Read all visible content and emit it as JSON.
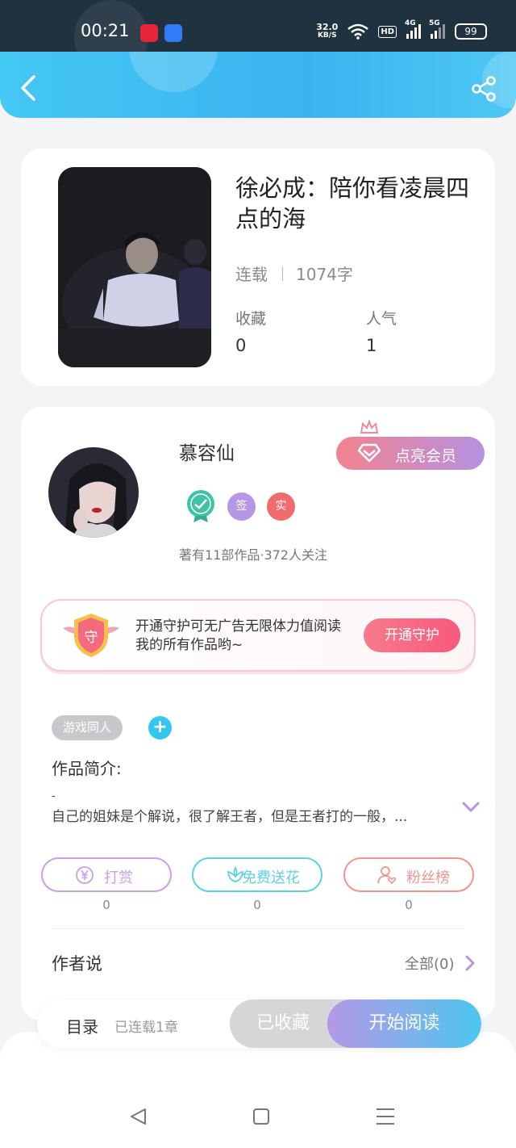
{
  "status_bar": {
    "time": "00:21",
    "net_speed_value": "32.0",
    "net_speed_unit": "KB/S",
    "hd_badge": "HD",
    "signal_4g": "4G",
    "signal_5g": "5G",
    "battery": "99"
  },
  "header": {
    "back_icon": "chevron-left-icon",
    "share_icon": "share-icon"
  },
  "book": {
    "title": "徐必成：陪你看凌晨四点的海",
    "status": "连载",
    "word_count": "1074字",
    "favorites_label": "收藏",
    "favorites_value": "0",
    "popularity_label": "人气",
    "popularity_value": "1"
  },
  "author": {
    "name": "慕容仙",
    "vip_button": "点亮会员",
    "badges": [
      "签",
      "实"
    ],
    "meta": "著有11部作品·372人关注"
  },
  "guard": {
    "icon_text": "守",
    "text": "开通守护可无广告无限体力值阅读我的所有作品哟~",
    "button": "开通守护"
  },
  "tags": [
    "游戏同人"
  ],
  "intro": {
    "label": "作品简介:",
    "dash": "-",
    "text": "自己的姐妹是个解说，很了解王者，但是王者打的一般，..."
  },
  "actions": [
    {
      "label": "打赏",
      "count": "0",
      "icon": "yen-icon",
      "color": "#c9a0e6"
    },
    {
      "label": "免费送花",
      "count": "0",
      "icon": "flower-icon",
      "color": "#5ecfe6"
    },
    {
      "label": "粉丝榜",
      "count": "0",
      "icon": "fan-user-icon",
      "color": "#f0948e"
    }
  ],
  "author_says": {
    "label": "作者说",
    "all": "全部(0)"
  },
  "bottom_bar": {
    "toc": "目录",
    "toc_sub": "已连载1章",
    "collected": "已收藏",
    "start_reading": "开始阅读"
  },
  "colors": {
    "header_blue": "#3bb3f0",
    "accent_pink": "#f9587e",
    "accent_purple": "#b690e2"
  }
}
